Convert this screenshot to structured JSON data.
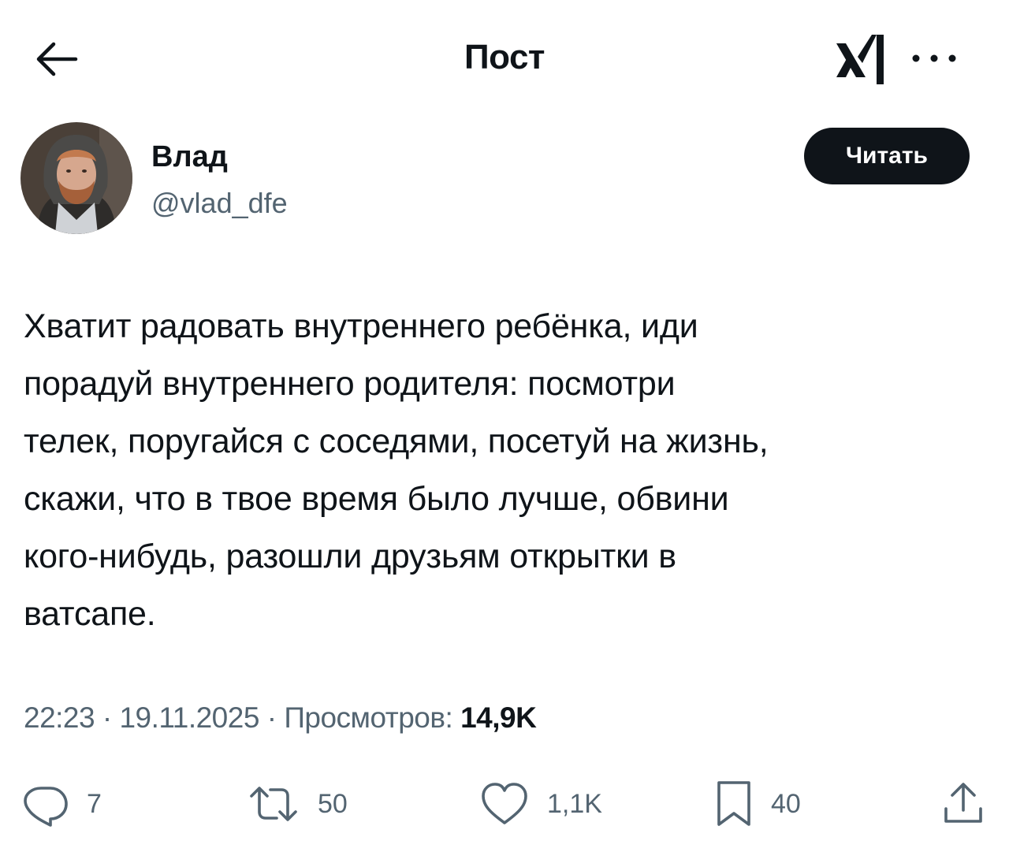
{
  "header": {
    "title": "Пост",
    "back_icon": "arrow-left-icon",
    "logo_icon": "x-ai-logo-icon",
    "more_icon": "more-dots-icon"
  },
  "author": {
    "name": "Влад",
    "handle": "@vlad_dfe",
    "follow_label": "Читать"
  },
  "post": {
    "lines": [
      "Хватит радовать внутреннего ребёнка, иди",
      "порадуй внутреннего родителя: посмотри",
      "телек, поругайся с соседями, посетуй на жизнь,",
      "скажи, что в твое время было лучше, обвини",
      "кого-нибудь, разошли друзьям открытки в",
      "ватсапе."
    ]
  },
  "meta": {
    "time": "22:23",
    "date": "19.11.2025",
    "views_label": "Просмотров:",
    "views_count": "14,9K",
    "separator": "·"
  },
  "actions": {
    "replies": "7",
    "reposts": "50",
    "likes": "1,1K",
    "bookmarks": "40"
  },
  "colors": {
    "text": "#0f1419",
    "secondary": "#536471",
    "button_bg": "#0f1419",
    "background": "#ffffff"
  }
}
